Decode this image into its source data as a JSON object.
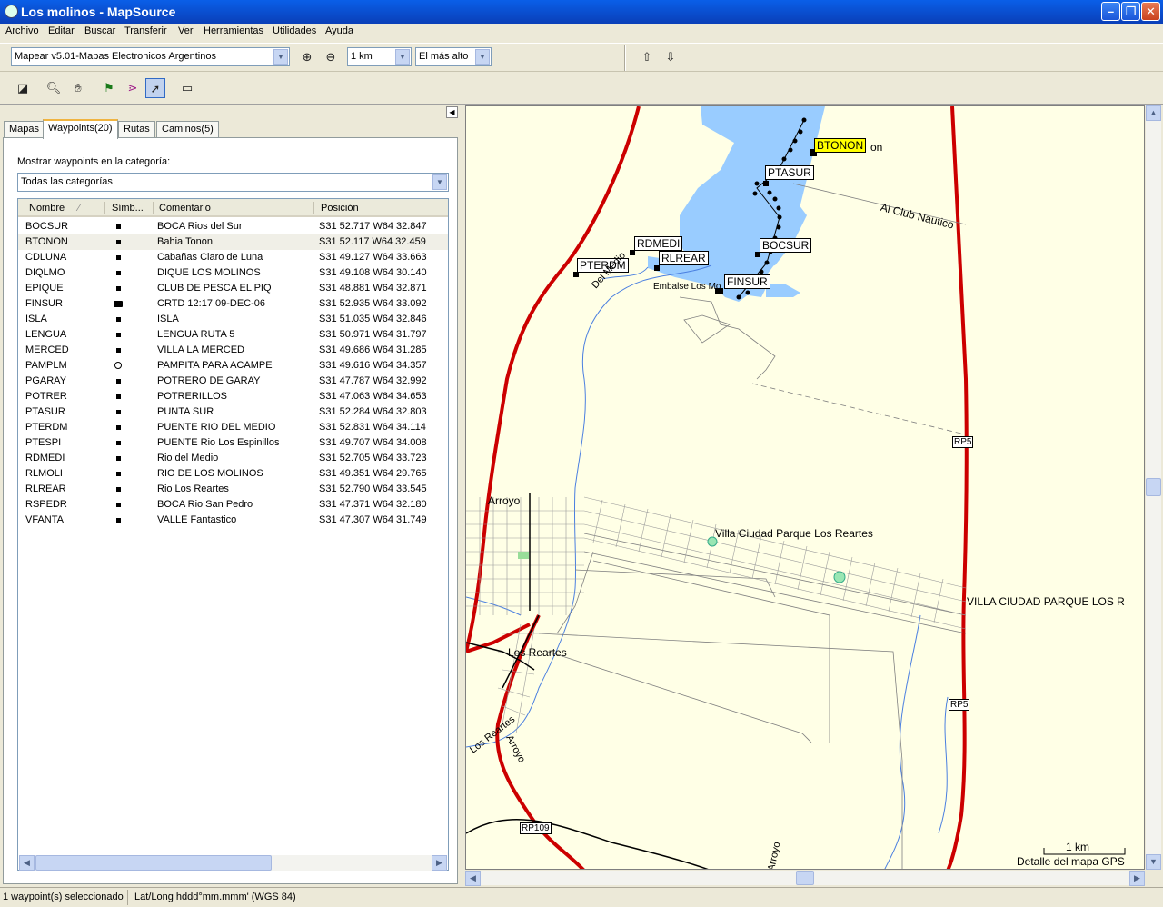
{
  "window": {
    "title": "Los molinos - MapSource",
    "app_icon": "globe-icon"
  },
  "menu": [
    "Archivo",
    "Editar",
    "Buscar",
    "Transferir",
    "Ver",
    "Herramientas",
    "Utilidades",
    "Ayuda"
  ],
  "toolbar": {
    "product_select": "Mapear v5.01-Mapas Electronicos Argentinos",
    "zoom_select": "1 km",
    "detail_select": "El más alto"
  },
  "tabs": [
    "Mapas",
    "Waypoints(20)",
    "Rutas",
    "Caminos(5)"
  ],
  "waypoint_panel": {
    "category_label": "Mostrar waypoints en la categoría:",
    "category_value": "Todas las categorías",
    "columns": [
      "Nombre",
      "Símb...",
      "Comentario",
      "Posición"
    ],
    "rows": [
      {
        "name": "BOCSUR",
        "symbol": "square",
        "comment": "BOCA Rios del Sur",
        "position": "S31 52.717 W64 32.847"
      },
      {
        "name": "BTONON",
        "symbol": "square",
        "comment": "Bahia Tonon",
        "position": "S31 52.117 W64 32.459",
        "selected": true
      },
      {
        "name": "CDLUNA",
        "symbol": "square",
        "comment": "Cabañas Claro de Luna",
        "position": "S31 49.127 W64 33.663"
      },
      {
        "name": "DIQLMO",
        "symbol": "square",
        "comment": "DIQUE LOS MOLINOS",
        "position": "S31 49.108 W64 30.140"
      },
      {
        "name": "EPIQUE",
        "symbol": "square",
        "comment": "CLUB DE PESCA EL PIQ",
        "position": "S31 48.881 W64 32.871"
      },
      {
        "name": "FINSUR",
        "symbol": "camera",
        "comment": "CRTD 12:17 09-DEC-06",
        "position": "S31 52.935 W64 33.092"
      },
      {
        "name": "ISLA",
        "symbol": "square",
        "comment": "ISLA",
        "position": "S31 51.035 W64 32.846"
      },
      {
        "name": "LENGUA",
        "symbol": "square",
        "comment": "LENGUA RUTA 5",
        "position": "S31 50.971 W64 31.797"
      },
      {
        "name": "MERCED",
        "symbol": "square",
        "comment": "VILLA LA MERCED",
        "position": "S31 49.686 W64 31.285"
      },
      {
        "name": "PAMPLM",
        "symbol": "circle",
        "comment": "PAMPITA PARA ACAMPE",
        "position": "S31 49.616 W64 34.357"
      },
      {
        "name": "PGARAY",
        "symbol": "square",
        "comment": "POTRERO DE GARAY",
        "position": "S31 47.787 W64 32.992"
      },
      {
        "name": "POTRER",
        "symbol": "square",
        "comment": "POTRERILLOS",
        "position": "S31 47.063 W64 34.653"
      },
      {
        "name": "PTASUR",
        "symbol": "square",
        "comment": "PUNTA SUR",
        "position": "S31 52.284 W64 32.803"
      },
      {
        "name": "PTERDM",
        "symbol": "square",
        "comment": "PUENTE RIO DEL MEDIO",
        "position": "S31 52.831 W64 34.114"
      },
      {
        "name": "PTESPI",
        "symbol": "square",
        "comment": "PUENTE Rio Los Espinillos",
        "position": "S31 49.707 W64 34.008"
      },
      {
        "name": "RDMEDI",
        "symbol": "square",
        "comment": "Rio del Medio",
        "position": "S31 52.705 W64 33.723"
      },
      {
        "name": "RLMOLI",
        "symbol": "square",
        "comment": "RIO DE LOS MOLINOS",
        "position": "S31 49.351 W64 29.765"
      },
      {
        "name": "RLREAR",
        "symbol": "square",
        "comment": "Rio Los Reartes",
        "position": "S31 52.790 W64 33.545"
      },
      {
        "name": "RSPEDR",
        "symbol": "square",
        "comment": "BOCA Rio San Pedro",
        "position": "S31 47.371 W64 32.180"
      },
      {
        "name": "VFANTA",
        "symbol": "square",
        "comment": "VALLE Fantastico",
        "position": "S31 47.307 W64 31.749"
      }
    ]
  },
  "map": {
    "waypoint_labels": {
      "btonon": "BTONON",
      "btonon_suffix": "on",
      "ptasur": "PTASUR",
      "rdmedi": "RDMEDI",
      "rlrear": "RLREAR",
      "pterdm": "PTERDM",
      "bocsur": "BOCSUR",
      "finsur": "FINSUR"
    },
    "place_labels": {
      "club": "Al Club Nautico",
      "embalse": "Embalse Los Mo",
      "del_medio": "Del Medio",
      "arroyo1": "Arroyo",
      "villa": "Villa Ciudad Parque Los Reartes",
      "villa_caps": "VILLA CIUDAD PARQUE LOS R",
      "los_reartes": "Los Reartes",
      "los_reartes_river": "Los Reartes",
      "arroyo2": "Arroyo",
      "arroyo3": "Arroyo"
    },
    "road_badges": {
      "rp5a": "RP5",
      "rp5b": "RP5",
      "rp109": "RP109"
    },
    "scale": {
      "label": "1 km",
      "detail": "Detalle del mapa GPS"
    },
    "colors": {
      "water": "#99ccff",
      "road_primary": "#cc0000",
      "background": "#ffffe6",
      "highlight": "#ffff00"
    }
  },
  "status": {
    "selection": "1 waypoint(s) seleccionado",
    "format": "Lat/Long hddd°mm.mmm' (WGS 84)"
  }
}
